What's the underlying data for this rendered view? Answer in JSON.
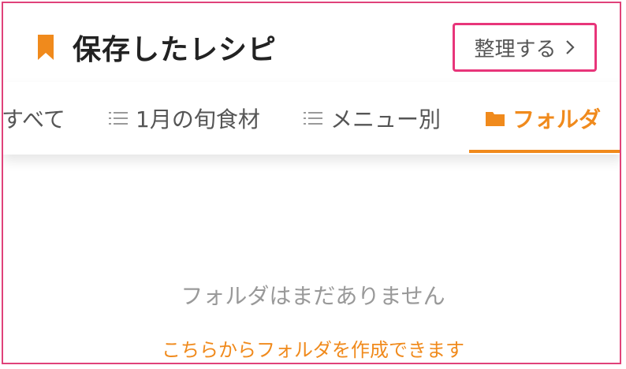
{
  "header": {
    "title": "保存したレシピ",
    "organize_label": "整理する",
    "icon": "bookmark-icon",
    "accent_color": "#f08a1c",
    "highlight_color": "#e8357a"
  },
  "tabs": [
    {
      "label": "すべて",
      "icon": "",
      "active": false
    },
    {
      "label": "1月の旬食材",
      "icon": "list-icon",
      "active": false
    },
    {
      "label": "メニュー別",
      "icon": "list-icon",
      "active": false
    },
    {
      "label": "フォルダ",
      "icon": "folder-icon",
      "active": true
    }
  ],
  "empty_state": {
    "message": "フォルダはまだありません",
    "create_link": "こちらからフォルダを作成できます"
  }
}
